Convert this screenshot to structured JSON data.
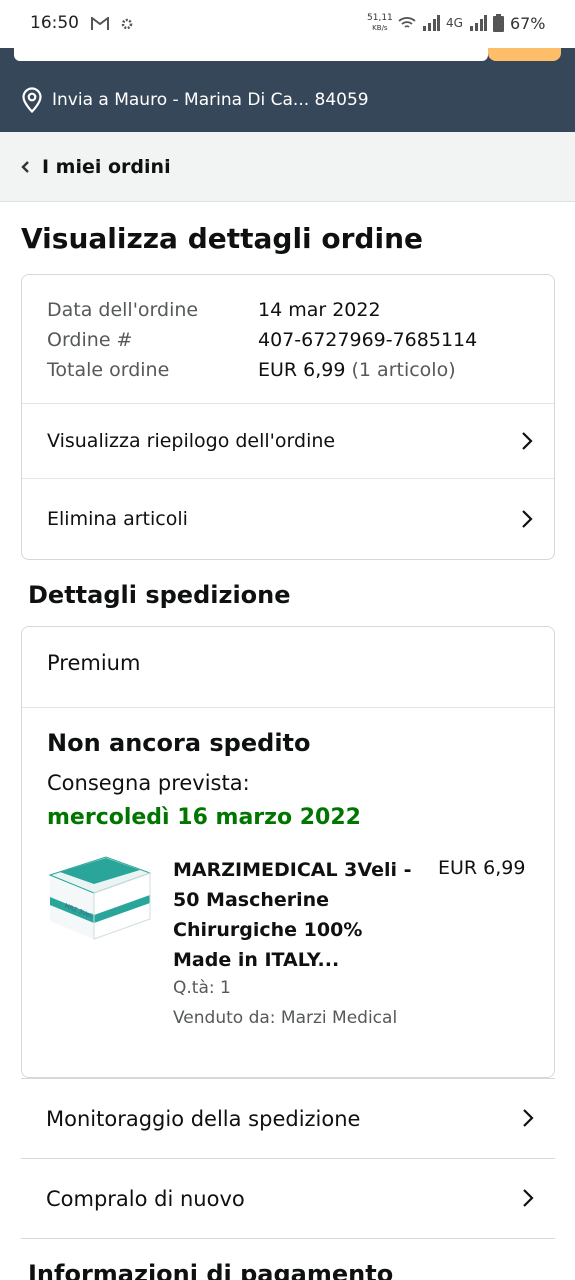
{
  "status_bar": {
    "time": "16:50",
    "net_speed_value": "51,11",
    "net_speed_unit": "KB/s",
    "network_type": "4G",
    "battery": "67%"
  },
  "header": {
    "deliver_to": "Invia a Mauro - Marina Di Ca... 84059"
  },
  "breadcrumb": {
    "label": "I miei ordini"
  },
  "page": {
    "title": "Visualizza dettagli ordine"
  },
  "order_info": {
    "rows": [
      {
        "label": "Data dell'ordine",
        "value": "14 mar 2022",
        "extra": ""
      },
      {
        "label": "Ordine #",
        "value": "407-6727969-7685114",
        "extra": ""
      },
      {
        "label": "Totale ordine",
        "value": "EUR 6,99",
        "extra": "(1 articolo)"
      }
    ],
    "view_summary": "Visualizza riepilogo dell'ordine",
    "delete_items": "Elimina articoli"
  },
  "shipping": {
    "section_title": "Dettagli spedizione",
    "service": "Premium",
    "status": "Non ancora spedito",
    "expected_label": "Consegna prevista:",
    "expected_date": "mercoledì 16 marzo 2022",
    "product": {
      "title": "MARZIMEDICAL 3Veli - 50 Mascherine Chirurgiche 100% Made in ITALY...",
      "price": "EUR 6,99",
      "quantity": "Q.tà: 1",
      "seller": "Venduto da: Marzi Medical"
    }
  },
  "actions": {
    "track": "Monitoraggio della spedizione",
    "buy_again": "Compralo di nuovo"
  },
  "payment": {
    "section_title": "Informazioni di pagamento"
  }
}
